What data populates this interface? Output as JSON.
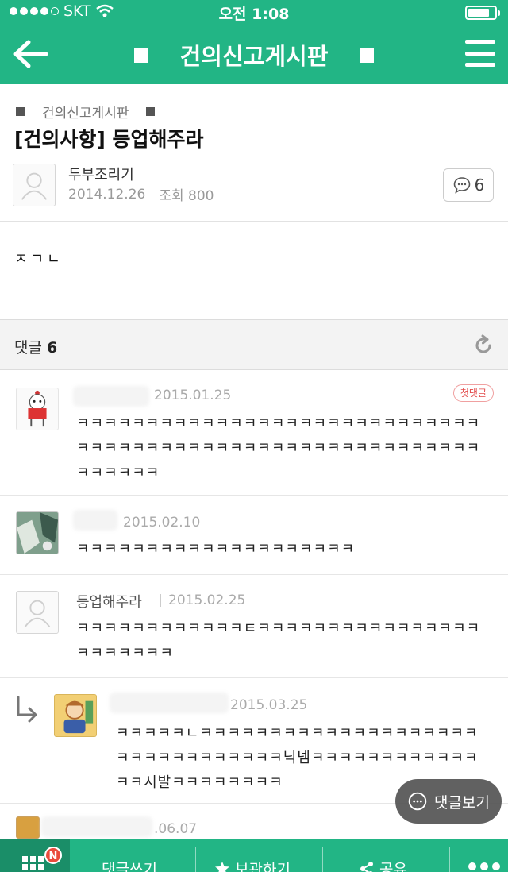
{
  "status_bar": {
    "carrier": "SKT",
    "time": "오전 1:08",
    "battery_level": 0.8
  },
  "nav": {
    "title": "건의신고게시판"
  },
  "post": {
    "board": "건의신고게시판",
    "title": "[건의사항] 등업해주라",
    "author": "두부조리기",
    "date": "2014.12.26",
    "views": "조회 800",
    "comment_count": "6",
    "body": "ㅈㄱㄴ"
  },
  "comments_header": {
    "label": "댓글",
    "count": "6"
  },
  "comments": [
    {
      "date": "2015.01.25",
      "badge": "첫댓글",
      "text": "ㅋㅋㅋㅋㅋㅋㅋㅋㅋㅋㅋㅋㅋㅋㅋㅋㅋㅋㅋㅋㅋㅋㅋㅋㅋㅋㅋㅋㅋㅋㅋㅋㅋㅋㅋㅋㅋㅋㅋㅋㅋㅋㅋㅋㅋㅋㅋㅋㅋㅋㅋㅋㅋㅋㅋㅋㅋㅋㅋㅋㅋㅋㅋㅋ"
    },
    {
      "date": "2015.02.10",
      "text": "ㅋㅋㅋㅋㅋㅋㅋㅋㅋㅋㅋㅋㅋㅋㅋㅋㅋㅋㅋㅋ"
    },
    {
      "name": "등업해주라",
      "date": "2015.02.25",
      "text": "ㅋㅋㅋㅋㅋㅋㅋㅋㅋㅋㅋㅋㅌㅋㅋㅋㅋㅋㅋㅋㅋㅋㅋㅋㅋㅋㅋㅋㅋㅋㅋㅋㅋㅋㅋㅋ"
    },
    {
      "date": "2015.03.25",
      "text": "ㅋㅋㅋㅋㅋㄴㅋㅋㅋㅋㅋㅋㅋㅋㅋㅋㅋㅋㅋㅋㅋㅋㅋㅋㅋㅋㅋㅋㅋㅋㅋㅋㅋㅋㅋㅋㅋㅋ닉넴ㅋㅋㅋㅋㅋㅋㅋㅋㅋㅋㅋㅋㅋㅋ시발ㅋㅋㅋㅋㅋㅋㅋㅋ"
    },
    {
      "date": ".06.07"
    }
  ],
  "floating": {
    "label": "댓글보기"
  },
  "bottom_bar": {
    "badge": "N",
    "write": "댓글쓰기",
    "bookmark": "보관하기",
    "share": "공유"
  },
  "colors": {
    "brand": "#22b585",
    "brand_dark": "#1a8e68",
    "badge_red": "#e94b3c"
  }
}
